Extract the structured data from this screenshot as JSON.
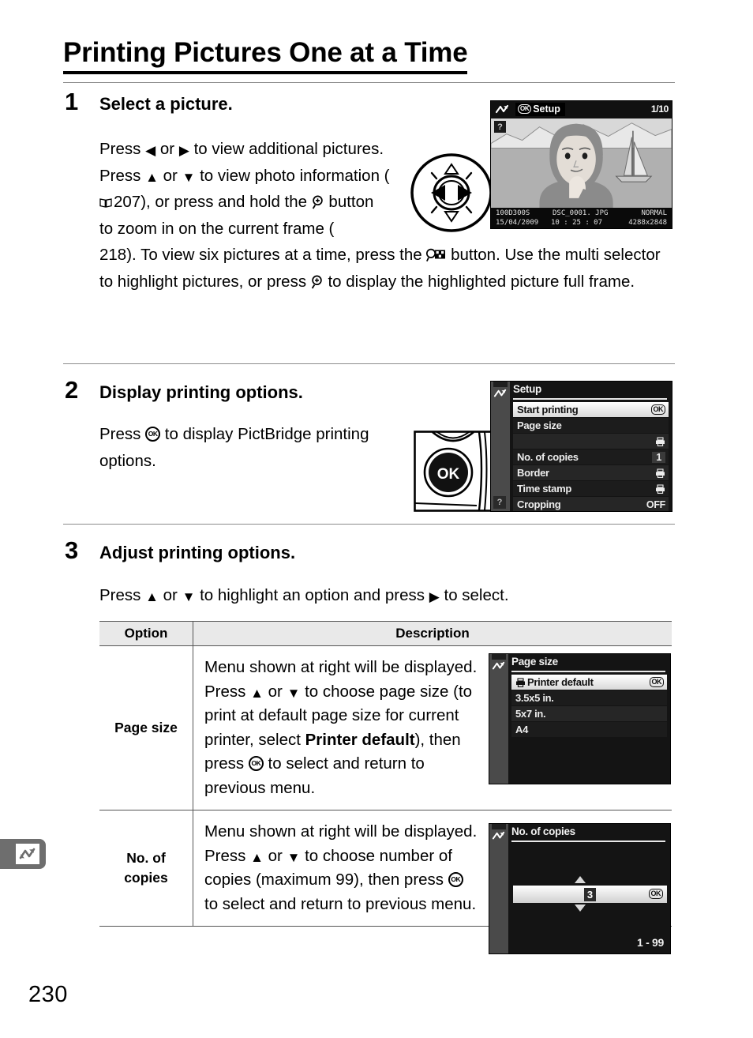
{
  "page": {
    "title": "Printing Pictures One at a Time",
    "number": "230",
    "side_tab_icon": "pictbridge-connection-icon"
  },
  "steps": [
    {
      "number": "1",
      "heading": "Select a picture.",
      "body_part1": "Press ",
      "body_part2": " or ",
      "body_part3": " to view additional pictures.  Press ",
      "body_part4": " or ",
      "body_part5": " to view photo information (",
      "ref1": "207",
      "body_part6": "), or press and hold the ",
      "body_part7": " button to zoom in on the current frame (",
      "ref2": "218",
      "body_part8": ").  To view six pictures at a time, press the ",
      "body_part9": " button.  Use the multi selector to highlight pictures, or press ",
      "body_part10": " to display the highlighted picture full frame."
    },
    {
      "number": "2",
      "heading": "Display printing options.",
      "body_part1": "Press ",
      "body_part2": " to display PictBridge printing options."
    },
    {
      "number": "3",
      "heading": "Adjust printing options.",
      "body_part1": "Press ",
      "body_part2": " or ",
      "body_part3": " to highlight an option and press ",
      "body_part4": " to select."
    }
  ],
  "playback_screen": {
    "pictbridge_icon": "pictbridge-icon",
    "setup_label": "Setup",
    "setup_ok_badge": "OK",
    "frame_counter": "1/10",
    "help_icon": "question-mark-icon",
    "folder": "100D300S",
    "filename": "DSC_0001. JPG",
    "quality": "NORMAL",
    "date": "15/04/2009",
    "time": "10 : 25 : 07",
    "dimensions": "4288x2848"
  },
  "setup_menu": {
    "title": "Setup",
    "items": [
      {
        "label": "Start printing",
        "value": "OK",
        "value_type": "ok-badge",
        "selected": true
      },
      {
        "label": "Page size",
        "value": "",
        "value_type": "none",
        "selected": false
      },
      {
        "label": "",
        "value": "",
        "value_type": "printer",
        "selected": false
      },
      {
        "label": "No. of copies",
        "value": "1",
        "value_type": "text-box",
        "selected": false
      },
      {
        "label": "Border",
        "value": "",
        "value_type": "printer",
        "selected": false
      },
      {
        "label": "Time stamp",
        "value": "",
        "value_type": "printer",
        "selected": false
      },
      {
        "label": "Cropping",
        "value": "OFF",
        "value_type": "text",
        "selected": false
      }
    ]
  },
  "page_size_menu": {
    "title": "Page size",
    "items": [
      {
        "label": "Printer default",
        "value": "OK",
        "value_type": "ok-badge",
        "has_printer_icon": true,
        "selected": true
      },
      {
        "label": "3.5x5 in.",
        "value": "",
        "value_type": "none",
        "has_printer_icon": false,
        "selected": false
      },
      {
        "label": "5x7 in.",
        "value": "",
        "value_type": "none",
        "has_printer_icon": false,
        "selected": false
      },
      {
        "label": "A4",
        "value": "",
        "value_type": "none",
        "has_printer_icon": false,
        "selected": false
      }
    ]
  },
  "copies_menu": {
    "title": "No. of copies",
    "value": "3",
    "ok_badge": "OK",
    "range": "1 - 99"
  },
  "table": {
    "headers": {
      "option": "Option",
      "description": "Description"
    },
    "rows": [
      {
        "option": "Page size",
        "option_line2": "",
        "desc_p1": "Menu shown at right will be displayed.  Press ",
        "desc_p2": " or ",
        "desc_p3": " to choose page size (to print at default page size for current printer, select ",
        "desc_bold": "Printer default",
        "desc_p4": "), then press ",
        "desc_p5": " to select and return to previous menu."
      },
      {
        "option": "No.  of",
        "option_line2": "copies",
        "desc_p1": "Menu shown at right will be displayed.  Press ",
        "desc_p2": " or ",
        "desc_p3": " to choose number of copies (maximum 99), then press ",
        "desc_bold": "",
        "desc_p4": "",
        "desc_p5": " to select and return to previous menu."
      }
    ]
  },
  "icons": {
    "multi_selector": "multi-selector-dial-icon",
    "ok_button": "ok-button-icon",
    "book_ref": "book-reference-icon",
    "zoom_in": "zoom-in-button-icon",
    "thumbnail": "thumbnail-button-icon"
  }
}
